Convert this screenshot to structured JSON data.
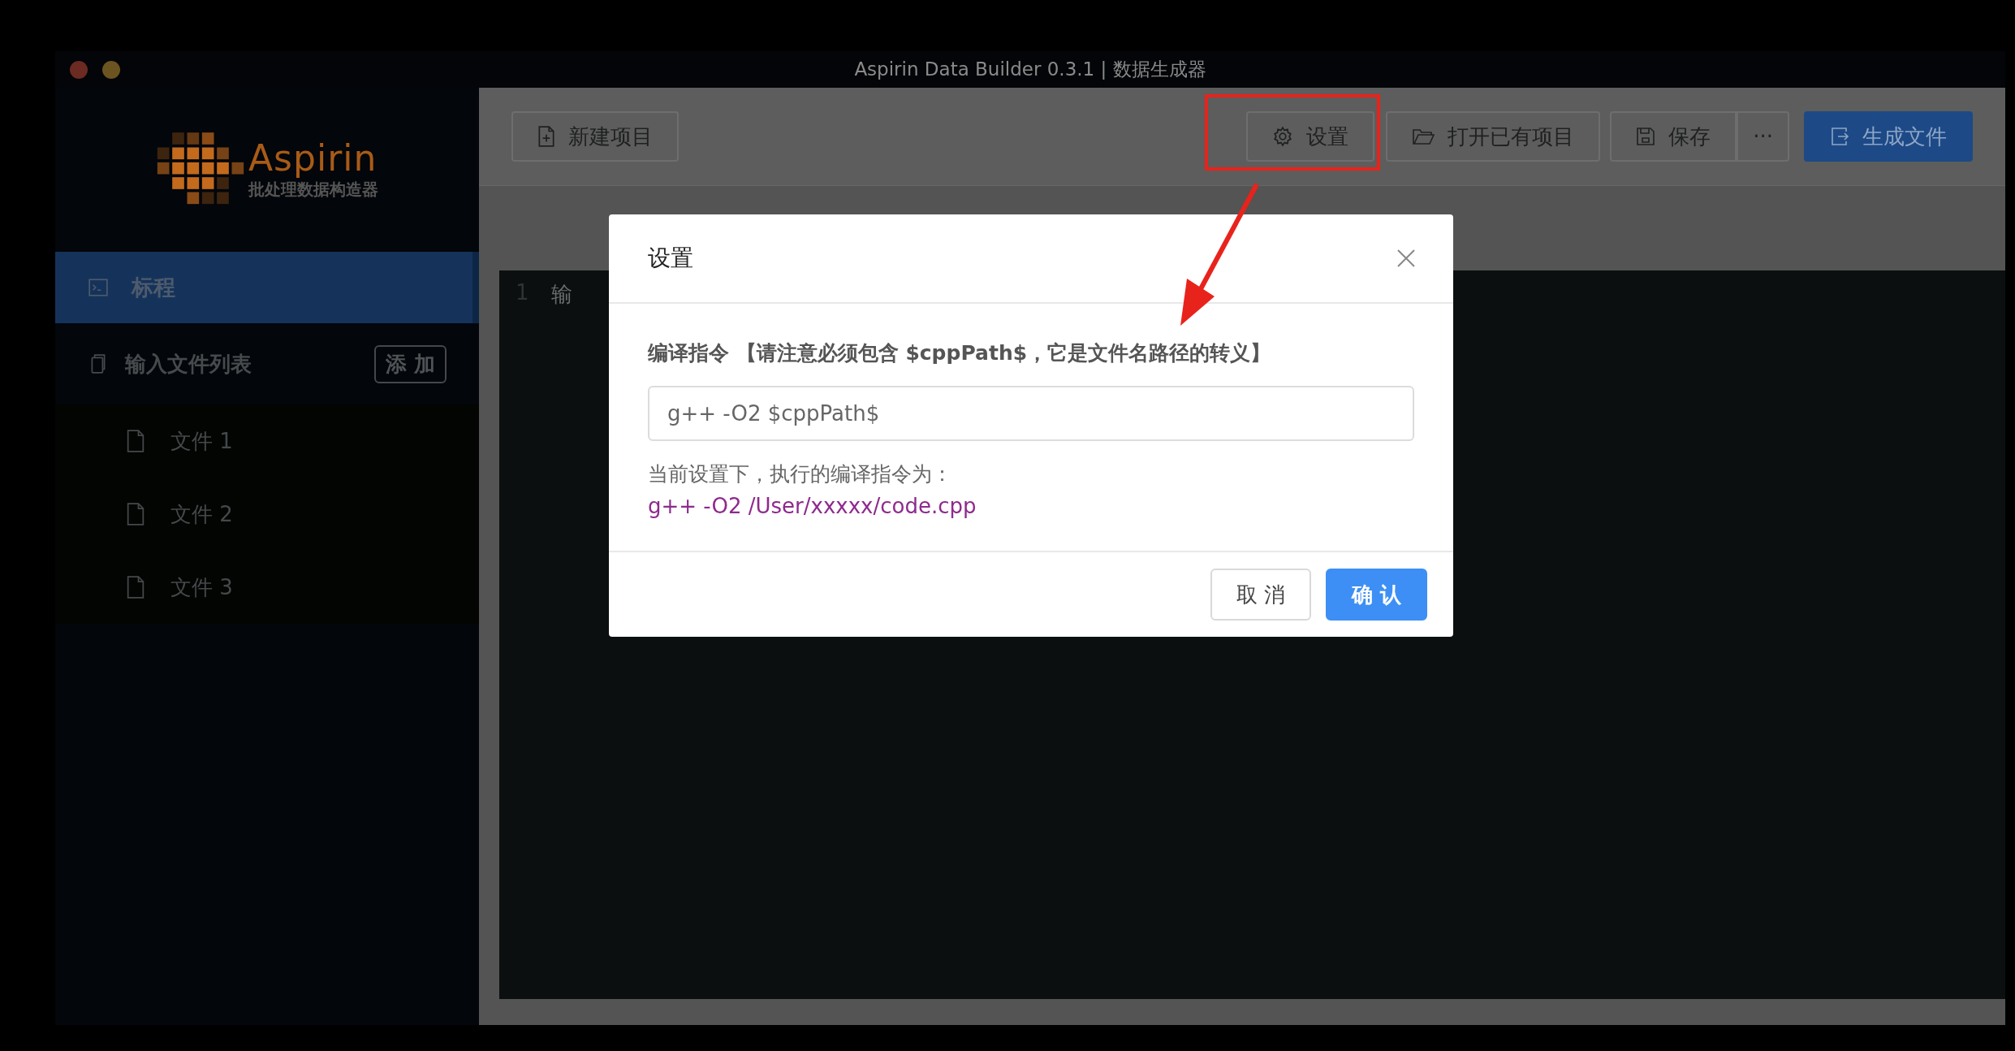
{
  "window": {
    "title": "Aspirin Data Builder 0.3.1 | 数据生成器"
  },
  "sidebar": {
    "logo": {
      "name": "Aspirin",
      "subtitle": "批处理数据构造器"
    },
    "items": [
      {
        "label": "标程",
        "selected": true
      }
    ],
    "file_list": {
      "label": "输入文件列表",
      "add_button": "添 加",
      "files": [
        {
          "label": "文件 1",
          "selected": false
        },
        {
          "label": "文件 2",
          "selected": false
        },
        {
          "label": "文件 3",
          "selected": false
        }
      ]
    }
  },
  "toolbar": {
    "left": [
      {
        "label": "新建项目",
        "kind": "new"
      }
    ],
    "right": [
      {
        "label": "设置",
        "kind": "settings"
      },
      {
        "label": "打开已有项目",
        "kind": "open"
      },
      {
        "label": "保存",
        "kind": "save"
      },
      {
        "label": "···",
        "kind": "more"
      },
      {
        "label": "生成文件",
        "kind": "generate"
      }
    ]
  },
  "editor": {
    "lines": [
      {
        "number": "1",
        "text": "输"
      }
    ]
  },
  "dialog": {
    "title": "设置",
    "field_label": "编译指令 【请注意必须包含 $cppPath$，它是文件名路径的转义】",
    "field_value": "g++ -O2 $cppPath$",
    "hint": "当前设置下，执行的编译指令为：",
    "preview": "g++ -O2 /User/xxxxx/code.cpp",
    "buttons": [
      {
        "label": "取 消",
        "kind": "secondary"
      },
      {
        "label": "确 认",
        "kind": "primary"
      }
    ]
  }
}
